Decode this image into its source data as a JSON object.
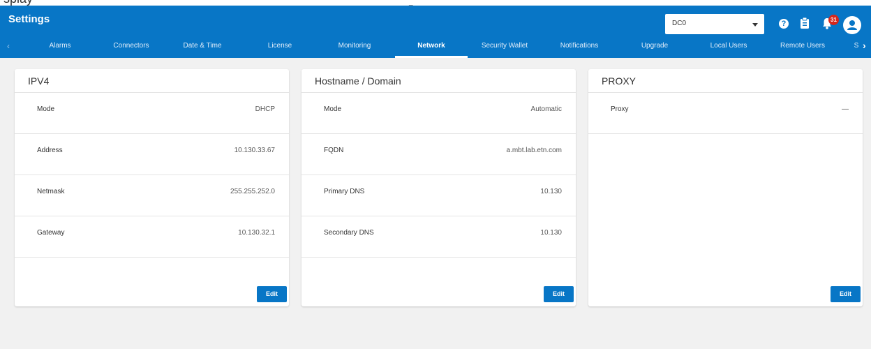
{
  "header": {
    "title": "Settings",
    "location_select": {
      "value": "DC0"
    },
    "notifications_count": "31"
  },
  "tabs": [
    {
      "label": "Alarms"
    },
    {
      "label": "Connectors"
    },
    {
      "label": "Date & Time"
    },
    {
      "label": "License"
    },
    {
      "label": "Monitoring"
    },
    {
      "label": "Network",
      "active": true
    },
    {
      "label": "Security Wallet"
    },
    {
      "label": "Notifications"
    },
    {
      "label": "Upgrade"
    },
    {
      "label": "Local Users"
    },
    {
      "label": "Remote Users"
    },
    {
      "label": "S"
    }
  ],
  "cards": {
    "ipv4": {
      "title": "IPV4",
      "rows": [
        {
          "label": "Mode",
          "value": "DHCP"
        },
        {
          "label": "Address",
          "value": "10.130.33.67"
        },
        {
          "label": "Netmask",
          "value": "255.255.252.0"
        },
        {
          "label": "Gateway",
          "value": "10.130.32.1"
        }
      ],
      "edit_label": "Edit"
    },
    "hostname": {
      "title": "Hostname / Domain",
      "rows": [
        {
          "label": "Mode",
          "value": "Automatic"
        },
        {
          "label": "FQDN",
          "value": "a.mbt.lab.etn.com"
        },
        {
          "label": "Primary DNS",
          "value": "10.130"
        },
        {
          "label": "Secondary DNS",
          "value": "10.130"
        }
      ],
      "edit_label": "Edit"
    },
    "proxy": {
      "title": "PROXY",
      "rows": [
        {
          "label": "Proxy",
          "value": "—"
        }
      ],
      "edit_label": "Edit"
    }
  },
  "colors": {
    "primary": "#0876c6",
    "badge": "#d7261b",
    "background": "#f1f1f1"
  }
}
